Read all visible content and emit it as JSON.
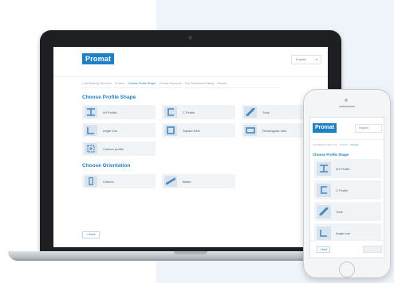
{
  "laptop": {
    "logo": "Promat",
    "language": "English",
    "breadcrumbs": [
      {
        "label": "Load Bearing Structure",
        "active": false
      },
      {
        "label": "Product",
        "active": false
      },
      {
        "label": "Choose Profile Shape",
        "active": true
      },
      {
        "label": "Choose Exposure",
        "active": false
      },
      {
        "label": "Fire Resistance Rating",
        "active": false
      },
      {
        "label": "Results",
        "active": false
      }
    ],
    "profile_title": "Choose Profile Shape",
    "profile_options": [
      {
        "label": "I/H Profile",
        "icon": "i-beam-icon"
      },
      {
        "label": "C Profile",
        "icon": "c-channel-icon"
      },
      {
        "label": "Tube",
        "icon": "round-tube-icon"
      },
      {
        "label": "Angle Iron",
        "icon": "angle-iron-icon"
      },
      {
        "label": "Square tube",
        "icon": "square-tube-icon"
      },
      {
        "label": "Rectangular tube",
        "icon": "rectangular-tube-icon"
      },
      {
        "label": "Custom profile",
        "icon": "custom-profile-icon"
      }
    ],
    "orientation_title": "Choose Orientation",
    "orientation_options": [
      {
        "label": "Column",
        "icon": "column-icon"
      },
      {
        "label": "Beam",
        "icon": "beam-icon"
      }
    ],
    "back_label": "< Back"
  },
  "phone": {
    "logo": "Promat",
    "language": "English",
    "breadcrumbs": [
      {
        "label": "Load Bearing Structure",
        "active": false
      },
      {
        "label": "Product",
        "active": false
      },
      {
        "label": "Choose",
        "active": true
      }
    ],
    "profile_title": "Choose Profile Shape",
    "profile_options": [
      {
        "label": "I/H Profile",
        "icon": "i-beam-icon"
      },
      {
        "label": "C Profile",
        "icon": "c-channel-icon"
      },
      {
        "label": "Tube",
        "icon": "round-tube-icon"
      },
      {
        "label": "Angle Iron",
        "icon": "angle-iron-icon"
      }
    ],
    "back_label": "< Back"
  },
  "colors": {
    "brand": "#1f80c3",
    "tile": "#f1f4f7",
    "icon_bg": "#d7e4ef"
  }
}
